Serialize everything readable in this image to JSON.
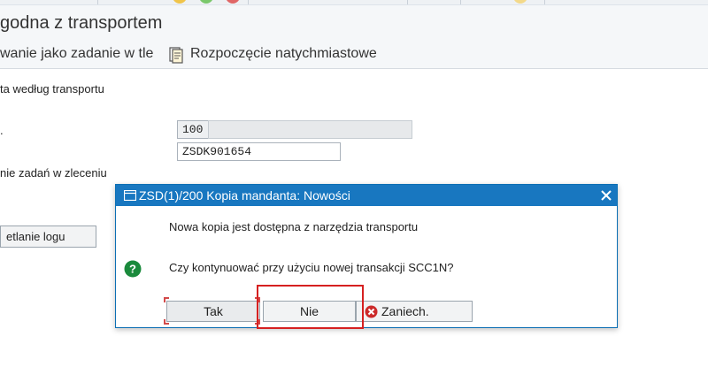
{
  "header": {
    "title": "godna z transportem"
  },
  "toolbar": {
    "background_job": "wanie jako zadanie w tle",
    "immediate_start": "Rozpoczęcie natychmiastowe"
  },
  "form": {
    "section_label": "ta według transportu",
    "row1_label": ".",
    "client_value": "100",
    "client_description": "",
    "transport_value": "ZSDK901654",
    "jobs_label": "nie zadań w zleceniu",
    "log_button": "etlanie logu"
  },
  "dialog": {
    "title": "ZSD(1)/200 Kopia mandanta: Nowości",
    "message": "Nowa kopia jest dostępna z narzędzia transportu",
    "question": "Czy kontynuować przy użyciu nowej transakcji SCC1N?",
    "buttons": {
      "yes": "Tak",
      "no": "Nie",
      "cancel": "Zaniech."
    }
  },
  "colors": {
    "dialog_header": "#1877c0",
    "question_icon": "#1a8a3c",
    "cancel_icon": "#cc2a2a",
    "highlight": "#d62020"
  },
  "icons": {
    "dialog_icon": "window-icon",
    "close": "close-icon",
    "question": "question-icon",
    "cancel": "cancel-icon",
    "immediate_start": "document-icon"
  }
}
